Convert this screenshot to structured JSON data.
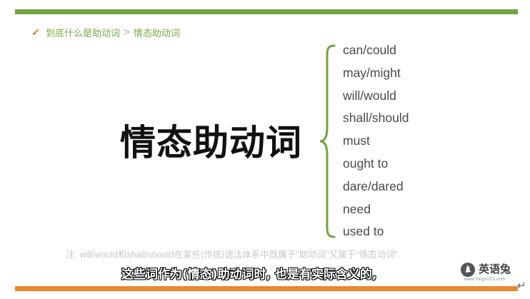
{
  "breadcrumb": {
    "icon": "pencil-icon",
    "parent": "到底什么是助动词",
    "separator": ">",
    "current": "情态助动词"
  },
  "main": {
    "title": "情态助动词",
    "verbs": [
      "can/could",
      "may/might",
      "will/would",
      "shall/should",
      "must",
      "ought to",
      "dare/dared",
      "need",
      "used to"
    ]
  },
  "note": "注: will/would和shall/should在某些(传统)语法体系中既属于\"助动词\"又属于\"情态动词\".",
  "subtitle": "这些词作为(情态)助动词时, 也是有实际含义的,",
  "brand": {
    "name": "英语兔",
    "url": "www.YingYuTu.com"
  },
  "colors": {
    "top_bar": "#72a442",
    "bottom_bar": "#e8892e",
    "accent_green": "#7aa84a"
  }
}
